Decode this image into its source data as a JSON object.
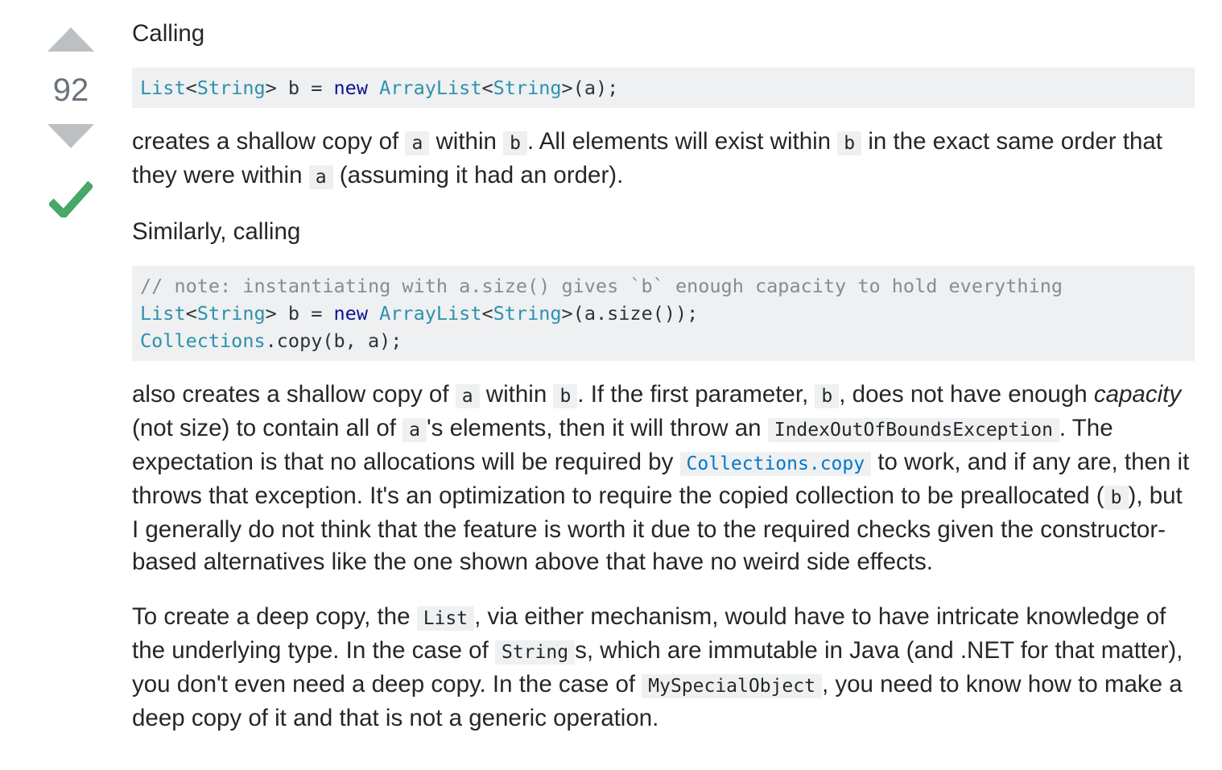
{
  "vote": {
    "count": "92",
    "accepted": true,
    "accent": "#48a868",
    "arrow_color": "#bbc0c4"
  },
  "post": {
    "p1": "Calling",
    "code1": {
      "t1": "List",
      "t2": "<",
      "t3": "String",
      "t4": "> b = ",
      "t5": "new",
      "t6": " ",
      "t7": "ArrayList",
      "t8": "<",
      "t9": "String",
      "t10": ">(a);"
    },
    "p2": {
      "s1": "creates a shallow copy of ",
      "c1": "a",
      "s2": " within ",
      "c2": "b",
      "s3": ". All elements will exist within ",
      "c3": "b",
      "s4": " in the exact same order that they were within ",
      "c4": "a",
      "s5": " (assuming it had an order)."
    },
    "p3": "Similarly, calling",
    "code2": {
      "comment": "// note: instantiating with a.size() gives `b` enough capacity to hold everything",
      "l2t1": "List",
      "l2t2": "<",
      "l2t3": "String",
      "l2t4": "> b = ",
      "l2t5": "new",
      "l2t6": " ",
      "l2t7": "ArrayList",
      "l2t8": "<",
      "l2t9": "String",
      "l2t10": ">(a.size());",
      "l3t1": "Collections",
      "l3t2": ".copy(b, a);"
    },
    "p4": {
      "s1": "also creates a shallow copy of ",
      "c1": "a",
      "s2": " within ",
      "c2": "b",
      "s3": ". If the first parameter, ",
      "c3": "b",
      "s4": ", does not have enough ",
      "em": "capacity",
      "s5": " (not size) to contain all of ",
      "c4": "a",
      "s6": "'s elements, then it will throw an ",
      "c5": "IndexOutOfBoundsException",
      "s7": ". The expectation is that no allocations will be required by ",
      "link": "Collections.copy",
      "s8": " to work, and if any are, then it throws that exception. It's an optimization to require the copied collection to be preallocated (",
      "c6": "b",
      "s9": "), but I generally do not think that the feature is worth it due to the required checks given the constructor-based alternatives like the one shown above that have no weird side effects."
    },
    "p5": {
      "s1": "To create a deep copy, the ",
      "c1": "List",
      "s2": ", via either mechanism, would have to have intricate knowledge of the underlying type. In the case of ",
      "c2": "String",
      "s3": "s, which are immutable in Java (and .NET for that matter), you don't even need a deep copy. In the case of ",
      "c3": "MySpecialObject",
      "s4": ", you need to know how to make a deep copy of it and that is not a generic operation."
    }
  }
}
